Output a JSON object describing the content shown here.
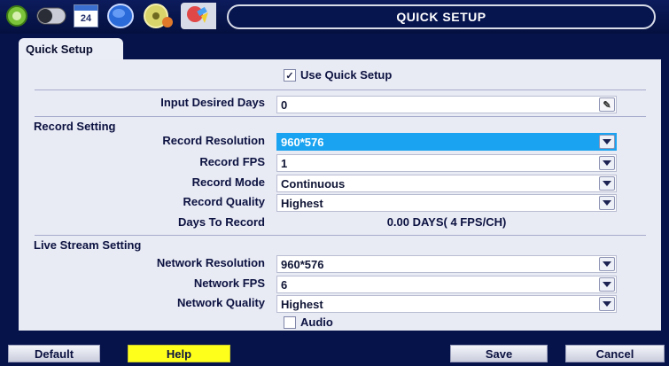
{
  "header": {
    "title": "QUICK SETUP",
    "calendar_day": "24"
  },
  "tabs": [
    {
      "label": "Quick Setup"
    }
  ],
  "quick_setup": {
    "use_label": "Use Quick Setup",
    "checked": true
  },
  "input_days": {
    "label": "Input Desired Days",
    "value": "0"
  },
  "record": {
    "section_title": "Record Setting",
    "resolution": {
      "label": "Record Resolution",
      "value": "960*576"
    },
    "fps": {
      "label": "Record FPS",
      "value": "1"
    },
    "mode": {
      "label": "Record Mode",
      "value": "Continuous"
    },
    "quality": {
      "label": "Record Quality",
      "value": "Highest"
    },
    "days": {
      "label": "Days To Record",
      "value": "0.00 DAYS( 4 FPS/CH)"
    }
  },
  "live": {
    "section_title": "Live Stream Setting",
    "resolution": {
      "label": "Network Resolution",
      "value": "960*576"
    },
    "fps": {
      "label": "Network FPS",
      "value": "6"
    },
    "quality": {
      "label": "Network Quality",
      "value": "Highest"
    },
    "audio": {
      "label": "Audio",
      "checked": false
    }
  },
  "buttons": {
    "default": "Default",
    "help": "Help",
    "save": "Save",
    "cancel": "Cancel"
  },
  "colors": {
    "background": "#06124a",
    "panel": "#e8eaf4",
    "selected": "#1aa3f0",
    "help": "#ffff1c"
  }
}
